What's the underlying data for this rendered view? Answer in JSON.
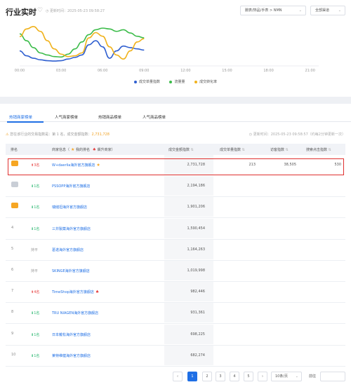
{
  "header": {
    "title": "行业实时",
    "updated": "更新时间：2025-05-23 09:58:27",
    "category_select": "腕表/饰品/手表 > NMN",
    "channel_select": "全部渠道"
  },
  "chart_data": {
    "type": "line",
    "x_ticks": [
      "00:00",
      "03:00",
      "06:00",
      "09:00",
      "12:00",
      "15:00",
      "18:00",
      "21:00"
    ],
    "x_hours": [
      0,
      0.5,
      1,
      1.5,
      2,
      2.5,
      3,
      3.5,
      4,
      4.5,
      5,
      5.5,
      6,
      6.5,
      7,
      7.5,
      8,
      8.5,
      9
    ],
    "y_range": [
      0,
      100
    ],
    "series": [
      {
        "name": "成交单量指数",
        "color": "#2f5fd0",
        "values": [
          30,
          18,
          12,
          8,
          6,
          5,
          6,
          10,
          14,
          20,
          45,
          55,
          40,
          12,
          30,
          42,
          38,
          35,
          32
        ]
      },
      {
        "name": "流量量",
        "color": "#3cbc4a",
        "values": [
          72,
          55,
          38,
          25,
          20,
          16,
          15,
          22,
          35,
          52,
          70,
          82,
          86,
          84,
          78,
          82,
          74,
          66,
          62
        ]
      },
      {
        "name": "成交转化率",
        "color": "#f0b21c",
        "values": [
          65,
          84,
          90,
          78,
          55,
          35,
          22,
          16,
          18,
          25,
          62,
          75,
          66,
          40,
          20,
          10,
          30,
          52,
          60
        ]
      }
    ]
  },
  "tabs": [
    "热销商家榜单",
    "人气商家榜单",
    "热销商品榜单",
    "人气商品榜单"
  ],
  "note": {
    "prefix": "⚠",
    "text": "您在该行业的交易指数是：第 1 名，成交金额指数：",
    "value": "2,731,728",
    "updated": "更新时间：2025-05-23 09:58:57（约每2分钟更新一次）"
  },
  "table": {
    "headers": {
      "rank": "排名",
      "shop": "商家信息（",
      "shop_star": "★",
      "shop_mid": " 我的排名 ",
      "shop_fire": "♠",
      "shop_tail": " 飙升商家）",
      "amount": "成交金额指数",
      "orders": "成交单量指数",
      "visits": "访客指数",
      "clicks": "搜索点击指数"
    },
    "rows": [
      {
        "rank": "1",
        "change": "3名",
        "name": "W+daerlia海外官方旗舰店",
        "amount": "2,731,728",
        "orders": "213",
        "visits": "38,505",
        "clicks": "530"
      },
      {
        "rank": "2",
        "change": "1名",
        "name": "PSSOPP海外官方旗舰店",
        "amount": "2,194,186",
        "orders": "",
        "visits": "",
        "clicks": ""
      },
      {
        "rank": "3",
        "change": "1名",
        "name": "瑞储坦海外官方旗舰店",
        "amount": "1,901,206",
        "orders": "",
        "visits": "",
        "clicks": ""
      },
      {
        "rank": "4",
        "change": "1名",
        "name": "三井製薬海外官方旗舰店",
        "amount": "1,590,454",
        "orders": "",
        "visits": "",
        "clicks": ""
      },
      {
        "rank": "5",
        "change": "持平",
        "name": "葛诺海外官方旗舰店",
        "amount": "1,164,263",
        "orders": "",
        "visits": "",
        "clicks": ""
      },
      {
        "rank": "6",
        "change": "持平",
        "name": "SKINGE海外官方旗舰店",
        "amount": "1,019,998",
        "orders": "",
        "visits": "",
        "clicks": ""
      },
      {
        "rank": "7",
        "change": "4名",
        "name": "TimeShop海外官方旗舰店",
        "amount": "982,446",
        "orders": "",
        "visits": "",
        "clicks": ""
      },
      {
        "rank": "8",
        "change": "1名",
        "name": "TRU NIAGEN海外官方旗舰店",
        "amount": "931,361",
        "orders": "",
        "visits": "",
        "clicks": ""
      },
      {
        "rank": "9",
        "change": "1名",
        "name": "日本戴松海外官方旗舰店",
        "amount": "698,225",
        "orders": "",
        "visits": "",
        "clicks": ""
      },
      {
        "rank": "10",
        "change": "1名",
        "name": "莱特维健海外官方旗舰店",
        "amount": "682,274",
        "orders": "",
        "visits": "",
        "clicks": ""
      }
    ]
  },
  "pager": {
    "prev": "‹",
    "pages": [
      "1",
      "2",
      "3",
      "4",
      "5"
    ],
    "next": "›",
    "size": "10条/页",
    "goto": "前往"
  }
}
